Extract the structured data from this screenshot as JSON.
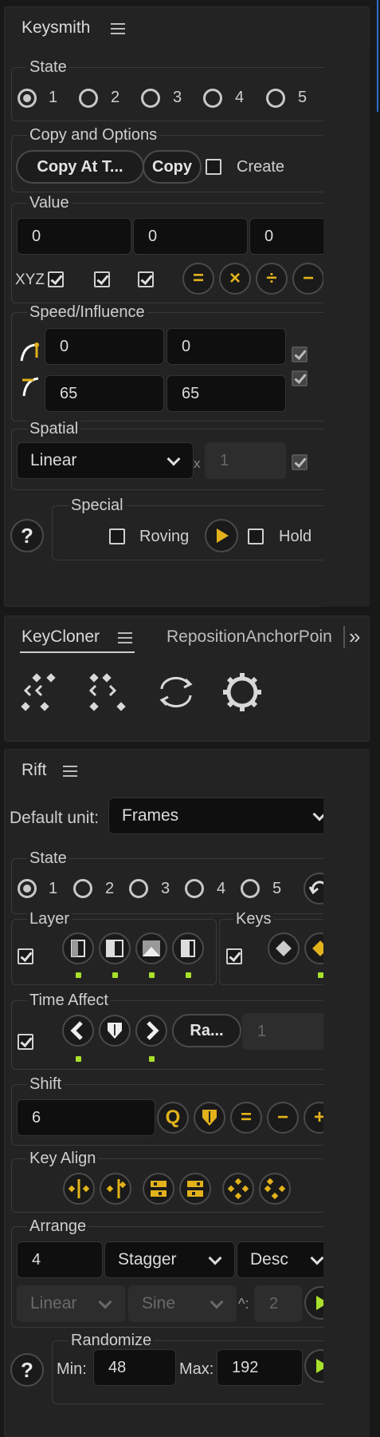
{
  "keysmith": {
    "title": "Keysmith",
    "state": {
      "label": "State",
      "options": [
        "1",
        "2",
        "3",
        "4",
        "5"
      ],
      "selected": "1"
    },
    "copy": {
      "label": "Copy and Options",
      "copy_at_label": "Copy At T...",
      "copy_label": "Copy",
      "create_label": "Create",
      "create_checked": false
    },
    "value": {
      "label": "Value",
      "fields": [
        "0",
        "0",
        "0"
      ],
      "xyz_label": "XYZ",
      "ops": [
        "=",
        "×",
        "÷",
        "−"
      ]
    },
    "speed": {
      "label": "Speed/Influence",
      "row1": [
        "0",
        "0"
      ],
      "row2": [
        "65",
        "65"
      ]
    },
    "spatial": {
      "label": "Spatial",
      "interp": "Linear",
      "x_label": "x",
      "multiplier": "1"
    },
    "special": {
      "label": "Special",
      "roving_label": "Roving",
      "hold_label": "Hold",
      "help": "?"
    }
  },
  "tabs": {
    "active": "KeyCloner",
    "other": "RepositionAnchorPoin",
    "overflow": "»"
  },
  "rift": {
    "title": "Rift",
    "default_unit_label": "Default unit:",
    "default_unit": "Frames",
    "state": {
      "label": "State",
      "options": [
        "1",
        "2",
        "3",
        "4",
        "5"
      ],
      "selected": "1"
    },
    "layer_label": "Layer",
    "keys_label": "Keys",
    "time_affect": {
      "label": "Time Affect",
      "mode": "Ra...",
      "value": "1"
    },
    "shift": {
      "label": "Shift",
      "value": "6",
      "ops": [
        "Q",
        "=",
        "−",
        "+"
      ]
    },
    "key_align_label": "Key Align",
    "arrange": {
      "label": "Arrange",
      "count": "4",
      "mode": "Stagger",
      "order": "Desc",
      "ease_in": "Linear",
      "ease_out": "Sine",
      "power_label": "^:",
      "power": "2"
    },
    "randomize": {
      "label": "Randomize",
      "min_label": "Min:",
      "min": "48",
      "max_label": "Max:",
      "max": "192",
      "help": "?"
    }
  },
  "colors": {
    "accent": "#e2b21b",
    "bg": "#232323",
    "active_dot": "#a8e02b"
  }
}
